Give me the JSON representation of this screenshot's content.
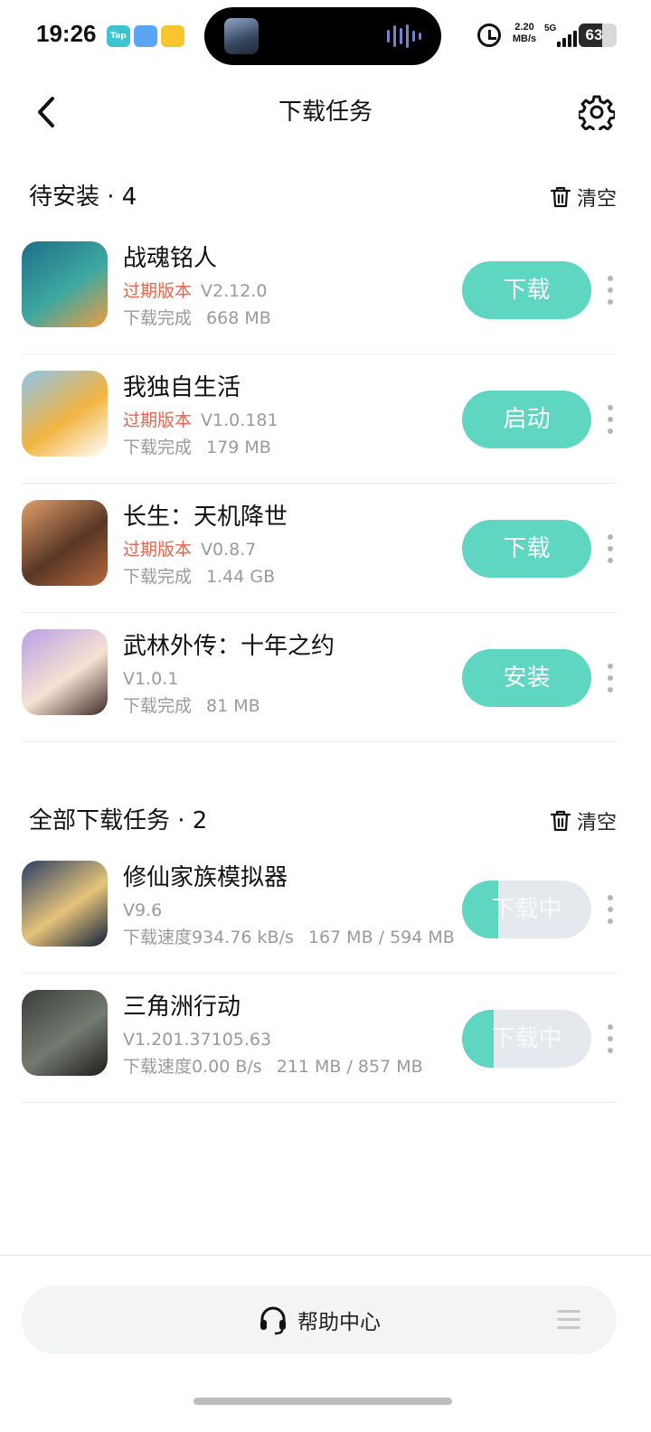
{
  "status_bar": {
    "time": "19:26",
    "apps": [
      {
        "name": "taptap-icon",
        "label": "Tap",
        "color": "#3cc5d0"
      },
      {
        "name": "cloud-app-icon",
        "label": "",
        "color": "#5aa6f5"
      },
      {
        "name": "notes-app-icon",
        "label": "",
        "color": "#f7c62f"
      }
    ],
    "net_speed_value": "2.20",
    "net_speed_unit": "MB/s",
    "network": "5G",
    "battery": "63",
    "battery_level": 0.63
  },
  "header": {
    "title": "下载任务",
    "back_icon": "chevron-left-icon",
    "settings_icon": "gear-icon"
  },
  "pending_section": {
    "title": "待安装 · 4",
    "clear_label": "清空",
    "items": [
      {
        "name": "战魂铭人",
        "outdated_label": "过期版本",
        "version": "V2.12.0",
        "status": "下载完成",
        "size": "668 MB",
        "action": "下载",
        "icon_colors": [
          "#1c6f8a",
          "#3fa8a0",
          "#f29a3c"
        ]
      },
      {
        "name": "我独自生活",
        "outdated_label": "过期版本",
        "version": "V1.0.181",
        "status": "下载完成",
        "size": "179 MB",
        "action": "启动",
        "icon_colors": [
          "#8fc6ec",
          "#f2b441",
          "#ffffff"
        ]
      },
      {
        "name": "长生：天机降世",
        "outdated_label": "过期版本",
        "version": "V0.8.7",
        "status": "下载完成",
        "size": "1.44 GB",
        "action": "下载",
        "icon_colors": [
          "#e0a06a",
          "#5a3626",
          "#b7693d"
        ]
      },
      {
        "name": "武林外传：十年之约",
        "outdated_label": "",
        "version": "V1.0.1",
        "status": "下载完成",
        "size": "81 MB",
        "action": "安装",
        "icon_colors": [
          "#b8a0e6",
          "#f6e2d2",
          "#3c2a28"
        ]
      }
    ]
  },
  "all_section": {
    "title": "全部下载任务 · 2",
    "clear_label": "清空",
    "items": [
      {
        "name": "修仙家族模拟器",
        "version": "V9.6",
        "speed_label": "下载速度",
        "speed": "934.76 kB/s",
        "progress_text": "167 MB / 594 MB",
        "action": "下载中",
        "progress": 0.28,
        "icon_colors": [
          "#2a3f63",
          "#e6c37a",
          "#12203a"
        ]
      },
      {
        "name": "三角洲行动",
        "version": "V1.201.37105.63",
        "speed_label": "下载速度",
        "speed": "0.00 B/s",
        "progress_text": "211 MB / 857 MB",
        "action": "下载中",
        "progress": 0.246,
        "icon_colors": [
          "#3a3e3a",
          "#757a70",
          "#1b1d1b"
        ]
      }
    ]
  },
  "bottom": {
    "help_label": "帮助中心",
    "help_icon": "headset-icon",
    "menu_icon": "menu-icon"
  }
}
